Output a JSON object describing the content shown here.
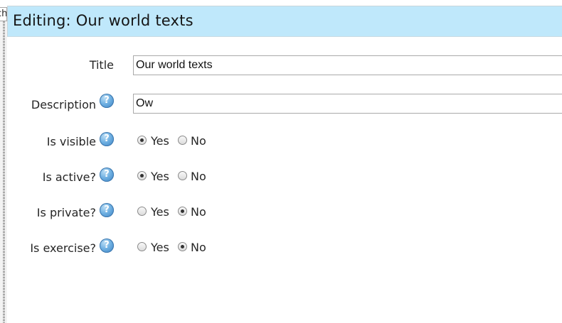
{
  "page": {
    "title": "Editing: Our world texts",
    "behind_text": "ch"
  },
  "form": {
    "title": {
      "label": "Title",
      "value": "Our world texts"
    },
    "description": {
      "label": "Description",
      "value": "Ow",
      "help_glyph": "?"
    },
    "is_visible": {
      "label": "Is visible",
      "help_glyph": "?",
      "yes_label": "Yes",
      "no_label": "No",
      "selected": "Yes"
    },
    "is_active": {
      "label": "Is active?",
      "help_glyph": "?",
      "yes_label": "Yes",
      "no_label": "No",
      "selected": "Yes"
    },
    "is_private": {
      "label": "Is private?",
      "help_glyph": "?",
      "yes_label": "Yes",
      "no_label": "No",
      "selected": "No"
    },
    "is_exercise": {
      "label": "Is exercise?",
      "help_glyph": "?",
      "yes_label": "Yes",
      "no_label": "No",
      "selected": "No"
    }
  },
  "colors": {
    "header_bg": "#bfe8fb",
    "help_icon": "#4a90d2"
  },
  "icons": {
    "help": "help-icon",
    "radio": "radio-button"
  }
}
